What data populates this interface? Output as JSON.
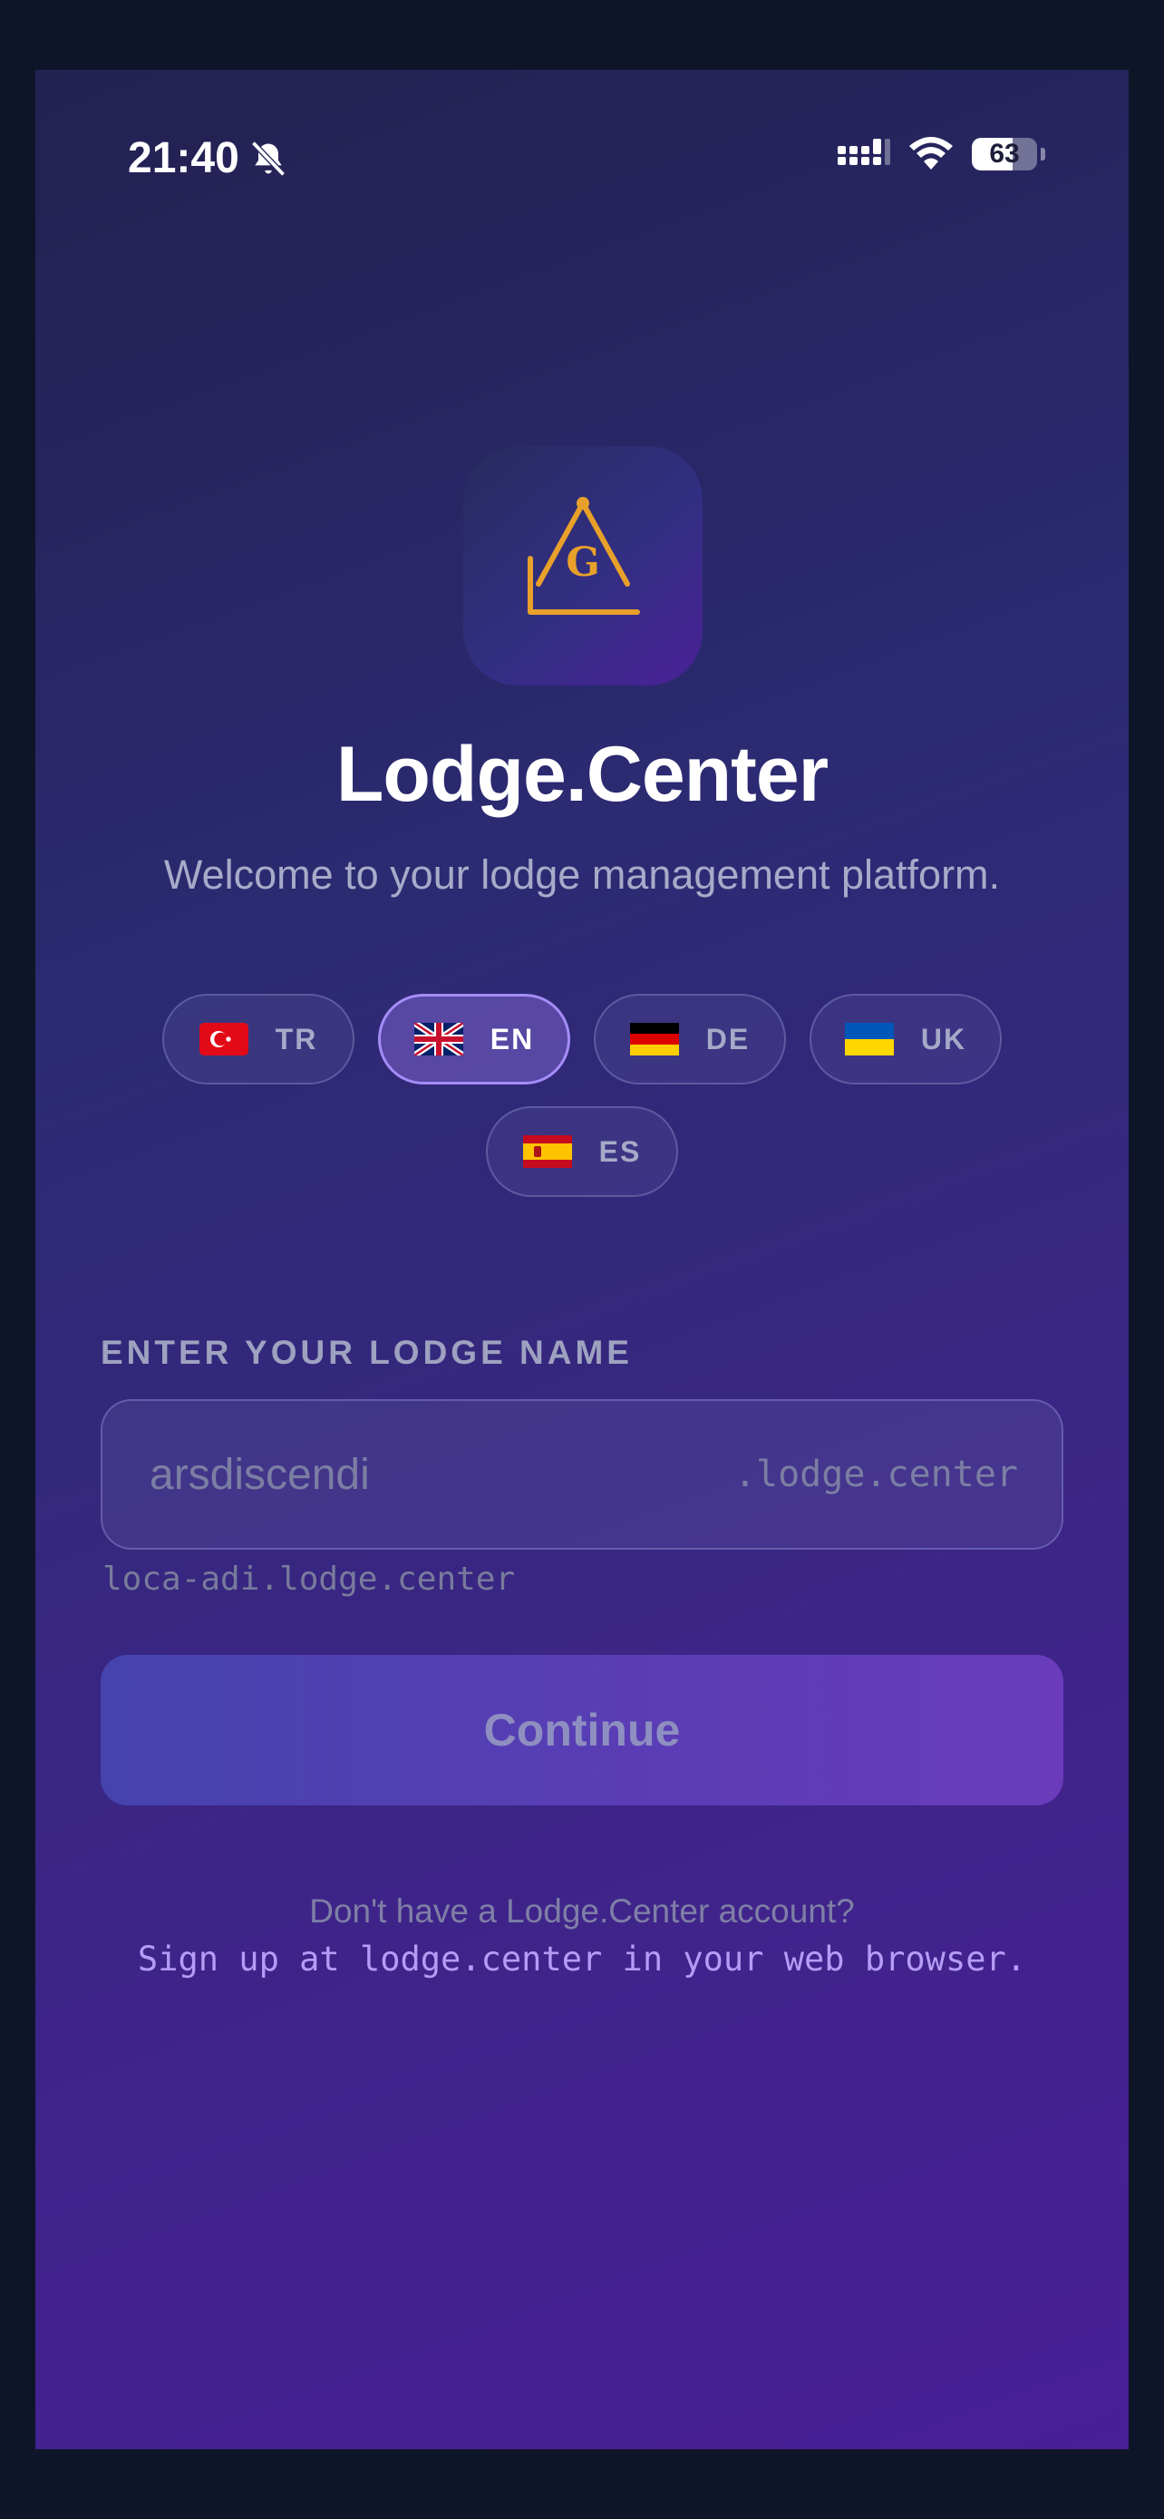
{
  "status_bar": {
    "time": "21:40",
    "battery": "63",
    "battery_level": 0.63,
    "icons": [
      "bell-slash-icon",
      "signal-icon",
      "wifi-icon",
      "battery-icon"
    ]
  },
  "app": {
    "logo_letter": "G",
    "title": "Lodge.Center",
    "subtitle": "Welcome to your lodge management platform."
  },
  "languages": [
    {
      "code": "TR",
      "flag": "flag-tr",
      "selected": false
    },
    {
      "code": "EN",
      "flag": "flag-gb",
      "selected": true
    },
    {
      "code": "DE",
      "flag": "flag-de",
      "selected": false
    },
    {
      "code": "UK",
      "flag": "flag-ua",
      "selected": false
    },
    {
      "code": "ES",
      "flag": "flag-es",
      "selected": false
    }
  ],
  "form": {
    "label": "ENTER YOUR LODGE NAME",
    "placeholder": "arsdiscendi",
    "value": "",
    "suffix": ".lodge.center",
    "hint": "loca-adi.lodge.center",
    "continue_label": "Continue"
  },
  "signup": {
    "question": "Don't have a Lodge.Center account?",
    "link": "Sign up at lodge.center in your web browser."
  },
  "colors": {
    "accent": "#a58cf7",
    "logo_gold": "#e8a02a",
    "link": "#b59cf7"
  }
}
